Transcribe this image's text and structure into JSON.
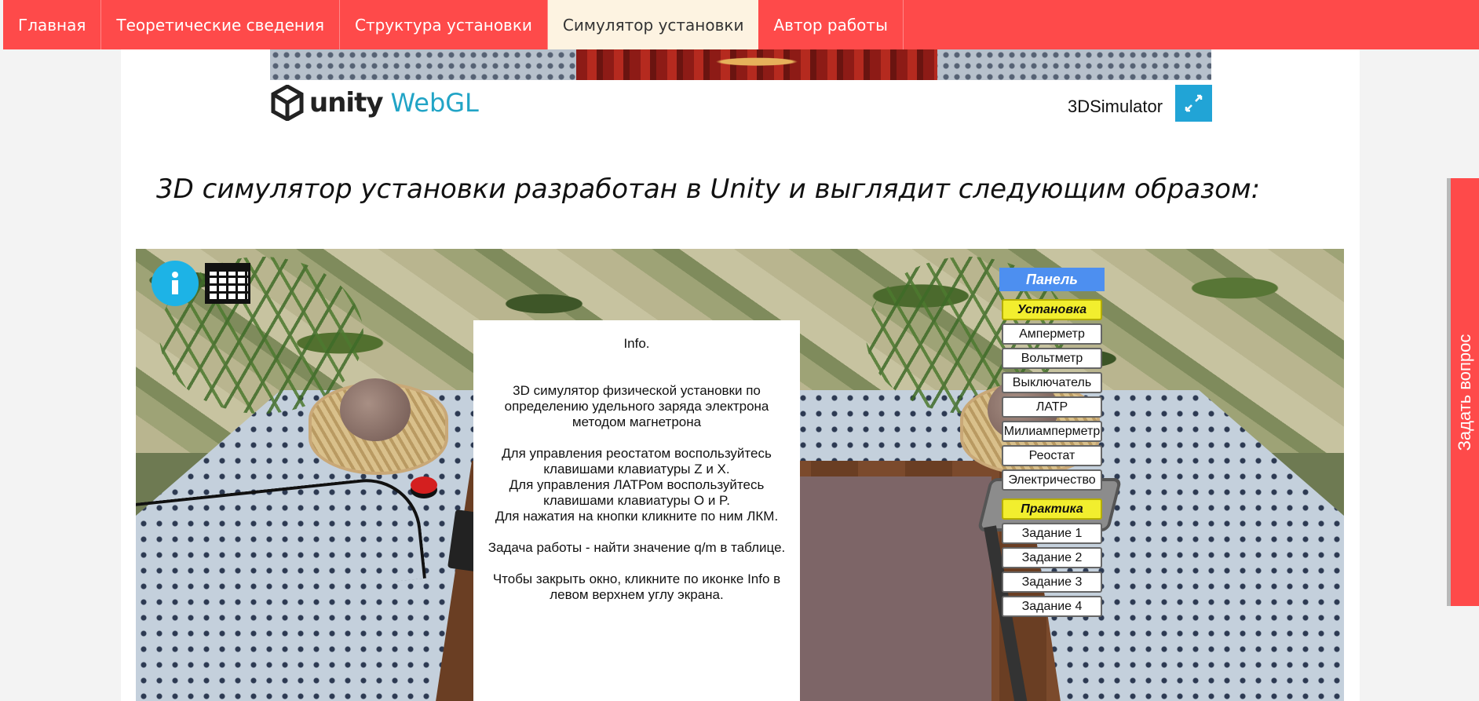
{
  "nav": {
    "items": [
      {
        "label": "Главная"
      },
      {
        "label": "Теоретические сведения"
      },
      {
        "label": "Структура установки"
      },
      {
        "label": "Симулятор установки",
        "active": true
      },
      {
        "label": "Автор работы"
      }
    ],
    "color": "#fe4a4a",
    "active_bg": "#fdf3e1"
  },
  "unity": {
    "logo_word": "unity",
    "webgl_word": "WebGL",
    "title": "3DSimulator",
    "fullscreen_icon": "fullscreen-icon"
  },
  "heading": "3D симулятор установки разработан в Unity и выглядит следующим образом:",
  "simulator": {
    "info_icon": "info-icon",
    "table_icon": "table-icon",
    "info_panel": {
      "title": "Info.",
      "paragraphs": [
        "3D симулятор физической установки по\nопределению удельного заряда электрона\nметодом магнетрона",
        "Для управления реостатом воспользуйтесь\nклавишами клавиатуры Z и X.\nДля управления ЛАТРом воспользуйтесь\nклавишами клавиатуры O и P.\nДля нажатия на кнопки кликните по ним ЛКМ.",
        "Задача работы - найти значение q/m в таблице.",
        "Чтобы закрыть окно, кликните по иконке Info в\nлевом верхнем углу экрана."
      ]
    },
    "panel": {
      "header": "Панель",
      "section_setup": "Установка",
      "setup_items": [
        "Амперметр",
        "Вольтметр",
        "Выключатель",
        "ЛАТР",
        "Милиамперметр",
        "Реостат",
        "Электричество"
      ],
      "section_practice": "Практика",
      "practice_items": [
        "Задание 1",
        "Задание 2",
        "Задание 3",
        "Задание 4"
      ]
    }
  },
  "ask_tab": {
    "label": "Задать вопрос",
    "color": "#fe4a4a"
  }
}
